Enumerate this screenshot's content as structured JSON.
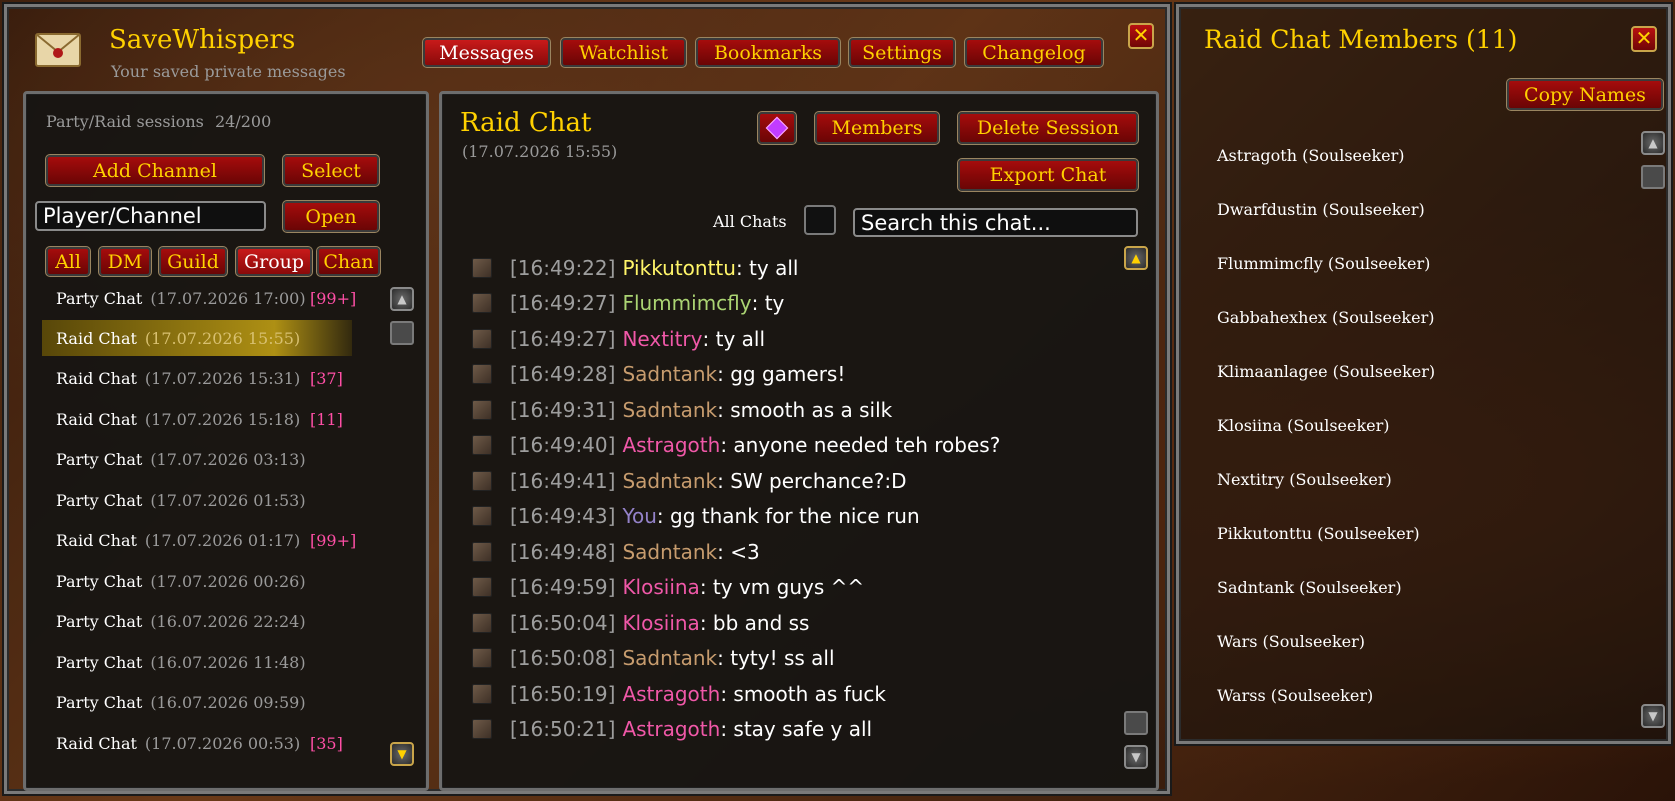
{
  "app": {
    "title": "SaveWhispers",
    "subtitle": "Your saved private messages"
  },
  "tabs": [
    {
      "label": "Messages",
      "active": true
    },
    {
      "label": "Watchlist"
    },
    {
      "label": "Bookmarks"
    },
    {
      "label": "Settings"
    },
    {
      "label": "Changelog"
    }
  ],
  "close_icon": "✕",
  "sidebar": {
    "sessions_label": "Party/Raid sessions",
    "sessions_count": "24/200",
    "add_channel": "Add Channel",
    "select": "Select",
    "player_input_value": "Player/Channel",
    "open": "Open",
    "filters": [
      "All",
      "DM",
      "Guild",
      "Group",
      "Chan"
    ],
    "active_filter": "Group",
    "sessions": [
      {
        "name": "Party Chat",
        "date": "(17.07.2026 17:00)",
        "badge": "[99+]"
      },
      {
        "name": "Raid Chat",
        "date": "(17.07.2026 15:55)",
        "badge": "",
        "selected": true
      },
      {
        "name": "Raid Chat",
        "date": "(17.07.2026 15:31)",
        "badge": "[37]"
      },
      {
        "name": "Raid Chat",
        "date": "(17.07.2026 15:18)",
        "badge": "[11]"
      },
      {
        "name": "Party Chat",
        "date": "(17.07.2026 03:13)",
        "badge": ""
      },
      {
        "name": "Party Chat",
        "date": "(17.07.2026 01:53)",
        "badge": ""
      },
      {
        "name": "Raid Chat",
        "date": "(17.07.2026 01:17)",
        "badge": "[99+]"
      },
      {
        "name": "Party Chat",
        "date": "(17.07.2026 00:26)",
        "badge": ""
      },
      {
        "name": "Party Chat",
        "date": "(16.07.2026 22:24)",
        "badge": ""
      },
      {
        "name": "Party Chat",
        "date": "(16.07.2026 11:48)",
        "badge": ""
      },
      {
        "name": "Party Chat",
        "date": "(16.07.2026 09:59)",
        "badge": ""
      },
      {
        "name": "Raid Chat",
        "date": "(17.07.2026 00:53)",
        "badge": "[35]"
      }
    ]
  },
  "chat": {
    "title": "Raid Chat",
    "date": "(17.07.2026 15:55)",
    "members_btn": "Members",
    "delete_btn": "Delete Session",
    "export_btn": "Export Chat",
    "all_chats_label": "All Chats",
    "search_placeholder": "Search this chat...",
    "messages": [
      {
        "time": "[16:49:22]",
        "name": "Pikkutonttu",
        "color": "#fff569",
        "text": ": ty all"
      },
      {
        "time": "[16:49:27]",
        "name": "Flummimcfly",
        "color": "#abd473",
        "text": ": ty"
      },
      {
        "time": "[16:49:27]",
        "name": "Nextitry",
        "color": "#f058a8",
        "text": ": ty all"
      },
      {
        "time": "[16:49:28]",
        "name": "Sadntank",
        "color": "#c79c6e",
        "text": ": gg gamers!"
      },
      {
        "time": "[16:49:31]",
        "name": "Sadntank",
        "color": "#c79c6e",
        "text": ": smooth as a silk"
      },
      {
        "time": "[16:49:40]",
        "name": "Astragoth",
        "color": "#f058a8",
        "text": ": anyone needed teh robes?"
      },
      {
        "time": "[16:49:41]",
        "name": "Sadntank",
        "color": "#c79c6e",
        "text": ": SW perchance?:D"
      },
      {
        "time": "[16:49:43]",
        "name": "You",
        "color": "#9482c9",
        "text": ": gg thank for the nice run"
      },
      {
        "time": "[16:49:48]",
        "name": "Sadntank",
        "color": "#c79c6e",
        "text": ": <3"
      },
      {
        "time": "[16:49:59]",
        "name": "Klosiina",
        "color": "#f058a8",
        "text": ": ty vm guys ^^"
      },
      {
        "time": "[16:50:04]",
        "name": "Klosiina",
        "color": "#f058a8",
        "text": ": bb and ss"
      },
      {
        "time": "[16:50:08]",
        "name": "Sadntank",
        "color": "#c79c6e",
        "text": ": tyty! ss all"
      },
      {
        "time": "[16:50:19]",
        "name": "Astragoth",
        "color": "#f058a8",
        "text": ": smooth as fuck"
      },
      {
        "time": "[16:50:21]",
        "name": "Astragoth",
        "color": "#f058a8",
        "text": ": stay safe y all"
      }
    ]
  },
  "members_panel": {
    "title": "Raid Chat Members (11)",
    "copy_names": "Copy Names",
    "members": [
      "Astragoth (Soulseeker)",
      "Dwarfdustin (Soulseeker)",
      "Flummimcfly (Soulseeker)",
      "Gabbahexhex (Soulseeker)",
      "Klimaanlagee (Soulseeker)",
      "Klosiina (Soulseeker)",
      "Nextitry (Soulseeker)",
      "Pikkutonttu (Soulseeker)",
      "Sadntank (Soulseeker)",
      "Wars (Soulseeker)",
      "Warss (Soulseeker)"
    ]
  },
  "colors": {
    "gold": "#ffd100",
    "badge": "#ff4fa6",
    "button_red": "#a50c0c"
  }
}
